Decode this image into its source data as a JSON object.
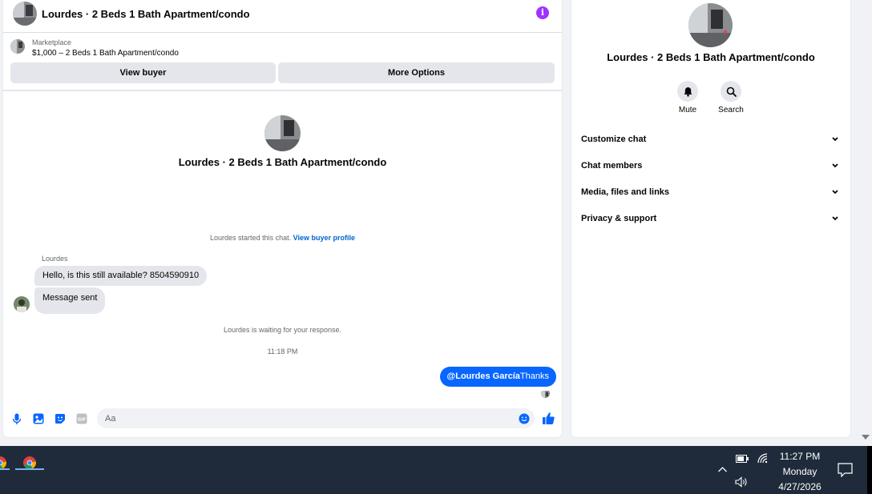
{
  "chat": {
    "header_title": "Lourdes · 2 Beds 1 Bath Apartment/condo",
    "info_icon": "info-icon",
    "marketplace_label": "Marketplace",
    "listing_title": "$1,000 – 2 Beds 1 Bath Apartment/condo",
    "view_buyer_label": "View buyer",
    "more_options_label": "More Options",
    "center_title": "Lourdes · 2 Beds 1 Bath Apartment/condo",
    "started_text": "Lourdes started this chat.",
    "view_profile_link": "View buyer profile",
    "sender_name": "Lourdes",
    "messages_in": [
      "Hello, is this still available? 8504590910",
      "Message sent"
    ],
    "waiting_text": "Lourdes is waiting for your response.",
    "timestamp": "11:18 PM",
    "out_message": {
      "mention": "@Lourdes García",
      "text": "Thanks"
    },
    "composer_placeholder": "Aa",
    "accent_color": "#0866ff"
  },
  "details": {
    "title": "Lourdes · 2 Beds 1 Bath Apartment/condo",
    "actions": [
      {
        "label": "Mute",
        "icon": "bell-icon"
      },
      {
        "label": "Search",
        "icon": "search-icon"
      }
    ],
    "sections": [
      "Customize chat",
      "Chat members",
      "Media, files and links",
      "Privacy & support"
    ]
  },
  "taskbar": {
    "time": "11:27 PM",
    "day": "Monday",
    "date": "4/27/2026"
  }
}
